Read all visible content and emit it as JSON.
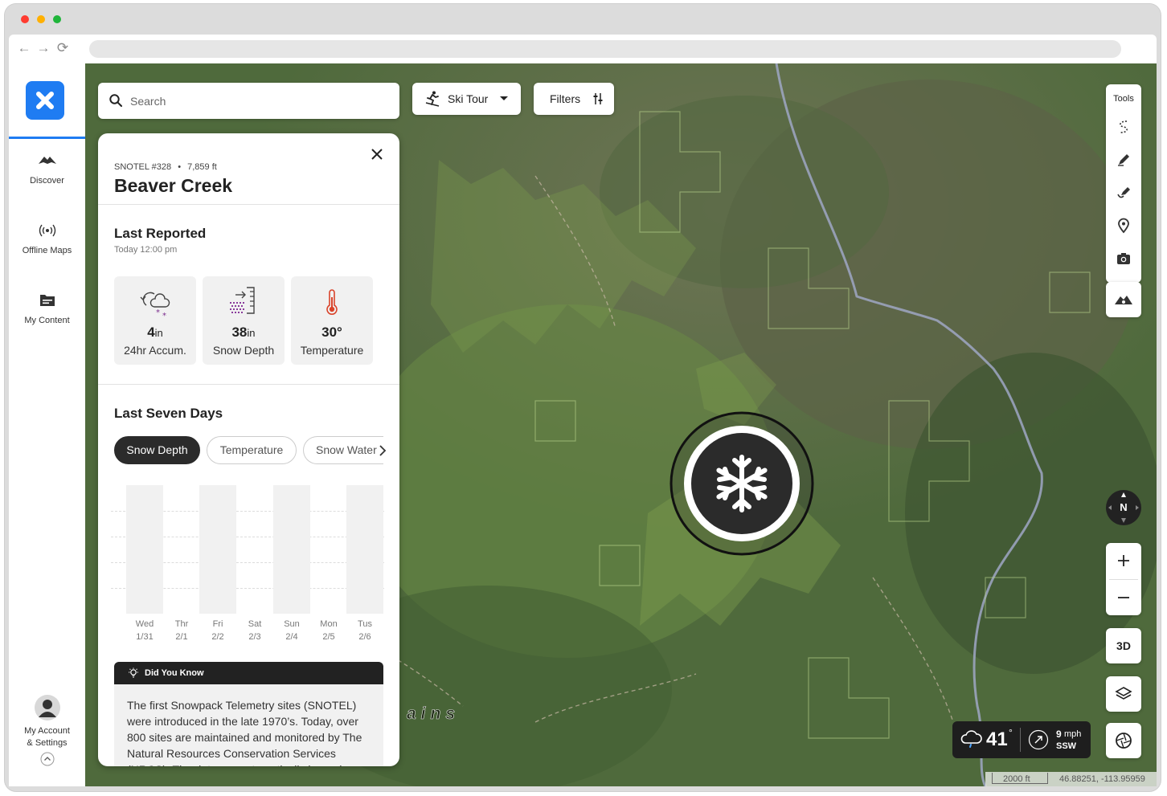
{
  "browser": {
    "url": ""
  },
  "sidebar": {
    "items": [
      {
        "label": "Discover",
        "icon": "mountain-icon"
      },
      {
        "label": "Offline Maps",
        "icon": "broadcast-icon"
      },
      {
        "label": "My Content",
        "icon": "folder-icon"
      }
    ],
    "account_line1": "My Account",
    "account_line2": "& Settings"
  },
  "search": {
    "placeholder": "Search"
  },
  "activity": {
    "label": "Ski Tour"
  },
  "filters": {
    "label": "Filters"
  },
  "panel": {
    "station": "SNOTEL #328",
    "elevation": "7,859 ft",
    "title": "Beaver Creek",
    "last_reported": {
      "heading": "Last Reported",
      "time": "Today 12:00 pm"
    },
    "stats": [
      {
        "value": "4",
        "unit": "in",
        "label": "24hr Accum.",
        "icon": "snowfall-icon"
      },
      {
        "value": "38",
        "unit": "in",
        "label": "Snow Depth",
        "icon": "snow-depth-icon"
      },
      {
        "value": "30°",
        "unit": "",
        "label": "Temperature",
        "icon": "thermometer-icon"
      }
    ],
    "seven_days": {
      "heading": "Last Seven Days",
      "tabs": [
        "Snow Depth",
        "Temperature",
        "Snow Water"
      ],
      "active_tab": 0,
      "days": [
        {
          "day": "Wed",
          "date": "1/31"
        },
        {
          "day": "Thr",
          "date": "2/1"
        },
        {
          "day": "Fri",
          "date": "2/2"
        },
        {
          "day": "Sat",
          "date": "2/3"
        },
        {
          "day": "Sun",
          "date": "2/4"
        },
        {
          "day": "Mon",
          "date": "2/5"
        },
        {
          "day": "Tus",
          "date": "2/6"
        }
      ]
    },
    "did_you_know": {
      "heading": "Did You Know",
      "text": "The first Snowpack Telemetry sites (SNOTEL) were introduced in the late 1970’s. Today, over 800 sites are maintained and monitored by The Natural Resources Conservation Services (NRCS). The data are automatically logged"
    }
  },
  "tools": {
    "label": "Tools",
    "items": [
      "route-icon",
      "pencil-icon",
      "marker-draw-icon",
      "pin-icon",
      "camera-icon"
    ]
  },
  "map_labels": {
    "mountains": "ains"
  },
  "compass": {
    "label": "N"
  },
  "view_3d": {
    "label": "3D"
  },
  "weather": {
    "temp": "41",
    "degree": "°",
    "wind_speed": "9",
    "wind_unit": "mph",
    "wind_dir": "SSW"
  },
  "scale": {
    "distance": "2000 ft",
    "coords": "46.88251, -113.95959"
  },
  "colors": {
    "brand": "#1f7cf2",
    "dark": "#222222",
    "snowflake_marker": "#2b2b2b"
  }
}
